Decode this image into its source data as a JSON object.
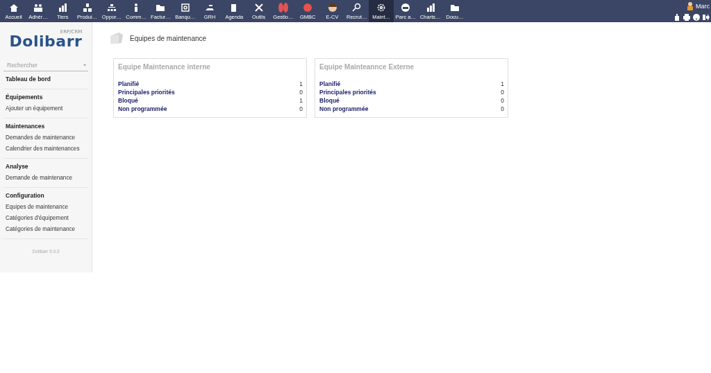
{
  "top_menu": [
    {
      "label": "Accueil",
      "selected": false
    },
    {
      "label": "Adhér…",
      "selected": false
    },
    {
      "label": "Tiers",
      "selected": false
    },
    {
      "label": "Produi…",
      "selected": false
    },
    {
      "label": "Oppor…",
      "selected": false
    },
    {
      "label": "Comm…",
      "selected": false
    },
    {
      "label": "Factur…",
      "selected": false
    },
    {
      "label": "Banqu…",
      "selected": false
    },
    {
      "label": "GRH",
      "selected": false
    },
    {
      "label": "Agenda",
      "selected": false
    },
    {
      "label": "Outils",
      "selected": false
    },
    {
      "label": "Gestio…",
      "selected": false
    },
    {
      "label": "GMBC",
      "selected": false
    },
    {
      "label": "E-CV",
      "selected": false
    },
    {
      "label": "Recrut…",
      "selected": false
    },
    {
      "label": "Maint…",
      "selected": true
    },
    {
      "label": "Parc a…",
      "selected": false
    },
    {
      "label": "Charts…",
      "selected": false
    },
    {
      "label": "Docu…",
      "selected": false
    }
  ],
  "user": {
    "name": "Marc"
  },
  "sidebar": {
    "logo": "Dolibarr",
    "logo_tag": "ERP/CRM",
    "search": {
      "placeholder": "Rechercher"
    },
    "sections": [
      {
        "title": "Tableau de bord"
      },
      {
        "title": "Équipements",
        "items": [
          "Ajouter un équipement"
        ]
      },
      {
        "title": "Maintenances",
        "items": [
          "Demandes de maintenance",
          "Calendrier des maintenances"
        ]
      },
      {
        "title": "Analyse",
        "items": [
          "Demande de maintenance"
        ]
      },
      {
        "title": "Configuration",
        "items": [
          "Equipes de maintenance",
          "Catégories d'équipement",
          "Catégories de maintenance"
        ]
      }
    ],
    "version": "Dolibarr 9.0.0"
  },
  "page": {
    "title": "Equipes de maintenance",
    "teams": [
      {
        "name": "Equipe Maintenance interne",
        "rows": [
          {
            "label": "Planifié",
            "value": "1"
          },
          {
            "label": "Principales priorités",
            "value": "0"
          },
          {
            "label": "Bloqué",
            "value": "1"
          },
          {
            "label": "Non programmée",
            "value": "0"
          }
        ]
      },
      {
        "name": "Equipe Mainteannce Externe",
        "rows": [
          {
            "label": "Planifié",
            "value": "1"
          },
          {
            "label": "Principales priorités",
            "value": "0"
          },
          {
            "label": "Bloqué",
            "value": "0"
          },
          {
            "label": "Non programmée",
            "value": "0"
          }
        ]
      }
    ]
  }
}
